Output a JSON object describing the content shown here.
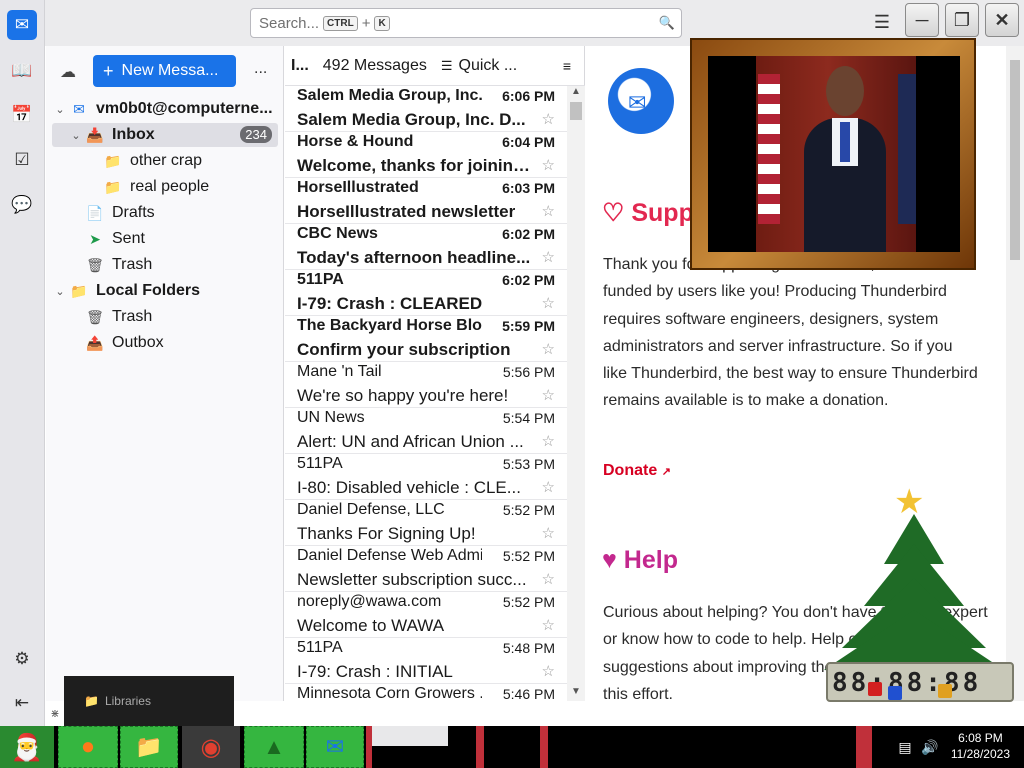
{
  "search": {
    "placeholder": "Search...",
    "shortcut_ctrl": "CTRL",
    "shortcut_plus": "+",
    "shortcut_key": "K"
  },
  "folder_pane": {
    "new_message_label": "New Messa...",
    "more_label": "...",
    "account": "vm0b0t@computerne...",
    "folders": [
      {
        "label": "Inbox",
        "badge": "234"
      },
      {
        "label": "other crap"
      },
      {
        "label": "real people"
      },
      {
        "label": "Drafts"
      },
      {
        "label": "Sent"
      },
      {
        "label": "Trash"
      }
    ],
    "local_folders": "Local Folders",
    "local_items": [
      {
        "label": "Trash"
      },
      {
        "label": "Outbox"
      }
    ]
  },
  "message_list": {
    "header_col": "I...",
    "count_label": "492 Messages",
    "quick_filter": "Quick ...",
    "messages": [
      {
        "sender": "Salem Media Group, Inc.",
        "time": "6:06 PM",
        "subject": "Salem Media Group, Inc. D...",
        "unread": true
      },
      {
        "sender": "Horse & Hound",
        "time": "6:04 PM",
        "subject": "Welcome, thanks for joining...",
        "unread": true
      },
      {
        "sender": "HorseIllustrated",
        "time": "6:03 PM",
        "subject": "HorseIllustrated newsletter",
        "unread": true
      },
      {
        "sender": "CBC News",
        "time": "6:02 PM",
        "subject": "Today's afternoon headline...",
        "unread": true
      },
      {
        "sender": "511PA",
        "time": "6:02 PM",
        "subject": "I-79: Crash : CLEARED",
        "unread": true
      },
      {
        "sender": "The Backyard Horse Blog",
        "time": "5:59 PM",
        "subject": "Confirm your subscription",
        "unread": true
      },
      {
        "sender": "Mane 'n Tail",
        "time": "5:56 PM",
        "subject": "We're so happy you're here!",
        "unread": false
      },
      {
        "sender": "UN News",
        "time": "5:54 PM",
        "subject": "Alert: UN and African Union ...",
        "unread": false
      },
      {
        "sender": "511PA",
        "time": "5:53 PM",
        "subject": "I-80: Disabled vehicle : CLE...",
        "unread": false
      },
      {
        "sender": "Daniel Defense, LLC",
        "time": "5:52 PM",
        "subject": "Thanks For Signing Up!",
        "unread": false
      },
      {
        "sender": "Daniel Defense Web Admin",
        "time": "5:52 PM",
        "subject": "Newsletter subscription succ...",
        "unread": false
      },
      {
        "sender": "noreply@wawa.com",
        "time": "5:52 PM",
        "subject": "Welcome to WAWA",
        "unread": false
      },
      {
        "sender": "511PA",
        "time": "5:48 PM",
        "subject": "I-79: Crash : INITIAL",
        "unread": false
      },
      {
        "sender": "Minnesota Corn Growers ...",
        "time": "5:46 PM",
        "subject": "",
        "unread": false
      }
    ]
  },
  "content": {
    "support_heading": "Supp",
    "support_text": "Thank you for supporting Thunderbird, which is funded by users like you! Producing Thunderbird requires software engineers, designers, system administrators and server infrastructure. So if you like Thunderbird, the best way to ensure Thunderbird remains available is to make a donation.",
    "donate_label": "Donate",
    "help_heading": "Help",
    "help_text": "Curious about helping? You don't have to be an expert or know how to code to help. Help others or offer suggestions about improving the experience! Join us in this effort."
  },
  "overlays": {
    "libraries_label": "Libraries",
    "clock_digits": "88:88:88"
  },
  "taskbar": {
    "time": "6:08 PM",
    "date": "11/28/2023"
  },
  "colors": {
    "accent": "#1a73e8",
    "support": "#e22850",
    "help": "#c3288e",
    "donate": "#d70022"
  }
}
